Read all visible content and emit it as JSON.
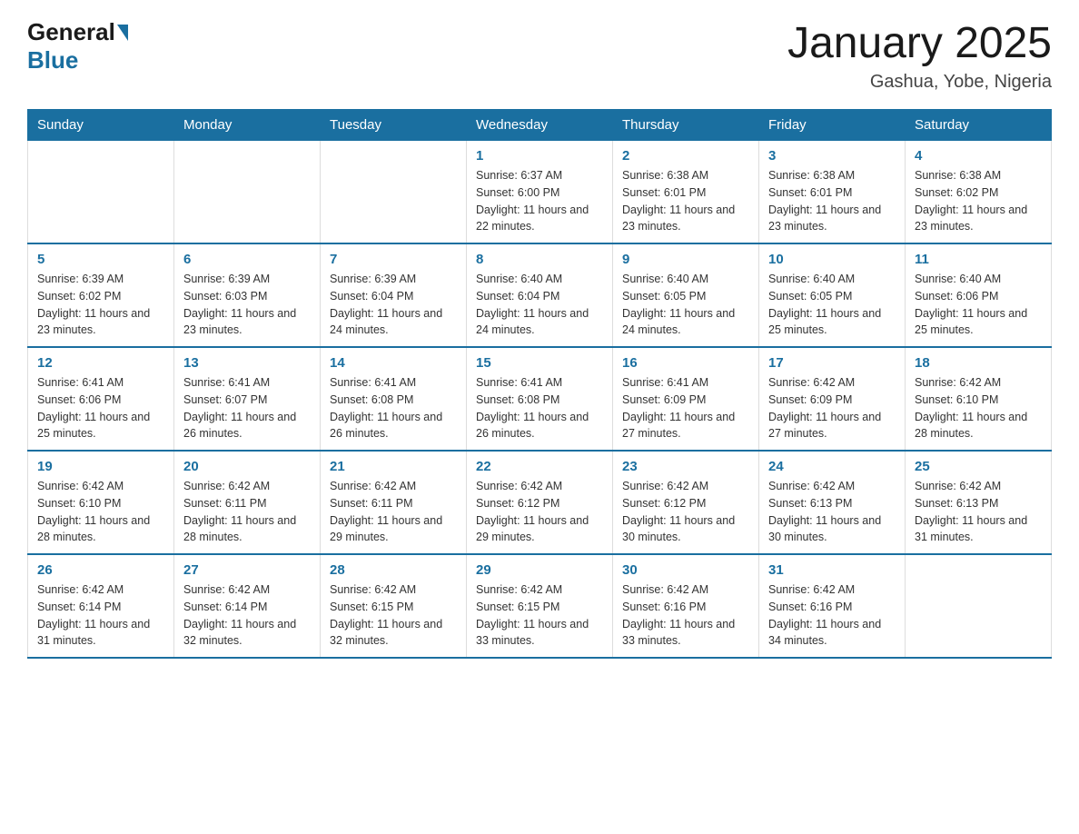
{
  "header": {
    "logo_general": "General",
    "logo_blue": "Blue",
    "month_title": "January 2025",
    "location": "Gashua, Yobe, Nigeria"
  },
  "days_of_week": [
    "Sunday",
    "Monday",
    "Tuesday",
    "Wednesday",
    "Thursday",
    "Friday",
    "Saturday"
  ],
  "weeks": [
    [
      {
        "day": "",
        "info": ""
      },
      {
        "day": "",
        "info": ""
      },
      {
        "day": "",
        "info": ""
      },
      {
        "day": "1",
        "info": "Sunrise: 6:37 AM\nSunset: 6:00 PM\nDaylight: 11 hours and 22 minutes."
      },
      {
        "day": "2",
        "info": "Sunrise: 6:38 AM\nSunset: 6:01 PM\nDaylight: 11 hours and 23 minutes."
      },
      {
        "day": "3",
        "info": "Sunrise: 6:38 AM\nSunset: 6:01 PM\nDaylight: 11 hours and 23 minutes."
      },
      {
        "day": "4",
        "info": "Sunrise: 6:38 AM\nSunset: 6:02 PM\nDaylight: 11 hours and 23 minutes."
      }
    ],
    [
      {
        "day": "5",
        "info": "Sunrise: 6:39 AM\nSunset: 6:02 PM\nDaylight: 11 hours and 23 minutes."
      },
      {
        "day": "6",
        "info": "Sunrise: 6:39 AM\nSunset: 6:03 PM\nDaylight: 11 hours and 23 minutes."
      },
      {
        "day": "7",
        "info": "Sunrise: 6:39 AM\nSunset: 6:04 PM\nDaylight: 11 hours and 24 minutes."
      },
      {
        "day": "8",
        "info": "Sunrise: 6:40 AM\nSunset: 6:04 PM\nDaylight: 11 hours and 24 minutes."
      },
      {
        "day": "9",
        "info": "Sunrise: 6:40 AM\nSunset: 6:05 PM\nDaylight: 11 hours and 24 minutes."
      },
      {
        "day": "10",
        "info": "Sunrise: 6:40 AM\nSunset: 6:05 PM\nDaylight: 11 hours and 25 minutes."
      },
      {
        "day": "11",
        "info": "Sunrise: 6:40 AM\nSunset: 6:06 PM\nDaylight: 11 hours and 25 minutes."
      }
    ],
    [
      {
        "day": "12",
        "info": "Sunrise: 6:41 AM\nSunset: 6:06 PM\nDaylight: 11 hours and 25 minutes."
      },
      {
        "day": "13",
        "info": "Sunrise: 6:41 AM\nSunset: 6:07 PM\nDaylight: 11 hours and 26 minutes."
      },
      {
        "day": "14",
        "info": "Sunrise: 6:41 AM\nSunset: 6:08 PM\nDaylight: 11 hours and 26 minutes."
      },
      {
        "day": "15",
        "info": "Sunrise: 6:41 AM\nSunset: 6:08 PM\nDaylight: 11 hours and 26 minutes."
      },
      {
        "day": "16",
        "info": "Sunrise: 6:41 AM\nSunset: 6:09 PM\nDaylight: 11 hours and 27 minutes."
      },
      {
        "day": "17",
        "info": "Sunrise: 6:42 AM\nSunset: 6:09 PM\nDaylight: 11 hours and 27 minutes."
      },
      {
        "day": "18",
        "info": "Sunrise: 6:42 AM\nSunset: 6:10 PM\nDaylight: 11 hours and 28 minutes."
      }
    ],
    [
      {
        "day": "19",
        "info": "Sunrise: 6:42 AM\nSunset: 6:10 PM\nDaylight: 11 hours and 28 minutes."
      },
      {
        "day": "20",
        "info": "Sunrise: 6:42 AM\nSunset: 6:11 PM\nDaylight: 11 hours and 28 minutes."
      },
      {
        "day": "21",
        "info": "Sunrise: 6:42 AM\nSunset: 6:11 PM\nDaylight: 11 hours and 29 minutes."
      },
      {
        "day": "22",
        "info": "Sunrise: 6:42 AM\nSunset: 6:12 PM\nDaylight: 11 hours and 29 minutes."
      },
      {
        "day": "23",
        "info": "Sunrise: 6:42 AM\nSunset: 6:12 PM\nDaylight: 11 hours and 30 minutes."
      },
      {
        "day": "24",
        "info": "Sunrise: 6:42 AM\nSunset: 6:13 PM\nDaylight: 11 hours and 30 minutes."
      },
      {
        "day": "25",
        "info": "Sunrise: 6:42 AM\nSunset: 6:13 PM\nDaylight: 11 hours and 31 minutes."
      }
    ],
    [
      {
        "day": "26",
        "info": "Sunrise: 6:42 AM\nSunset: 6:14 PM\nDaylight: 11 hours and 31 minutes."
      },
      {
        "day": "27",
        "info": "Sunrise: 6:42 AM\nSunset: 6:14 PM\nDaylight: 11 hours and 32 minutes."
      },
      {
        "day": "28",
        "info": "Sunrise: 6:42 AM\nSunset: 6:15 PM\nDaylight: 11 hours and 32 minutes."
      },
      {
        "day": "29",
        "info": "Sunrise: 6:42 AM\nSunset: 6:15 PM\nDaylight: 11 hours and 33 minutes."
      },
      {
        "day": "30",
        "info": "Sunrise: 6:42 AM\nSunset: 6:16 PM\nDaylight: 11 hours and 33 minutes."
      },
      {
        "day": "31",
        "info": "Sunrise: 6:42 AM\nSunset: 6:16 PM\nDaylight: 11 hours and 34 minutes."
      },
      {
        "day": "",
        "info": ""
      }
    ]
  ]
}
